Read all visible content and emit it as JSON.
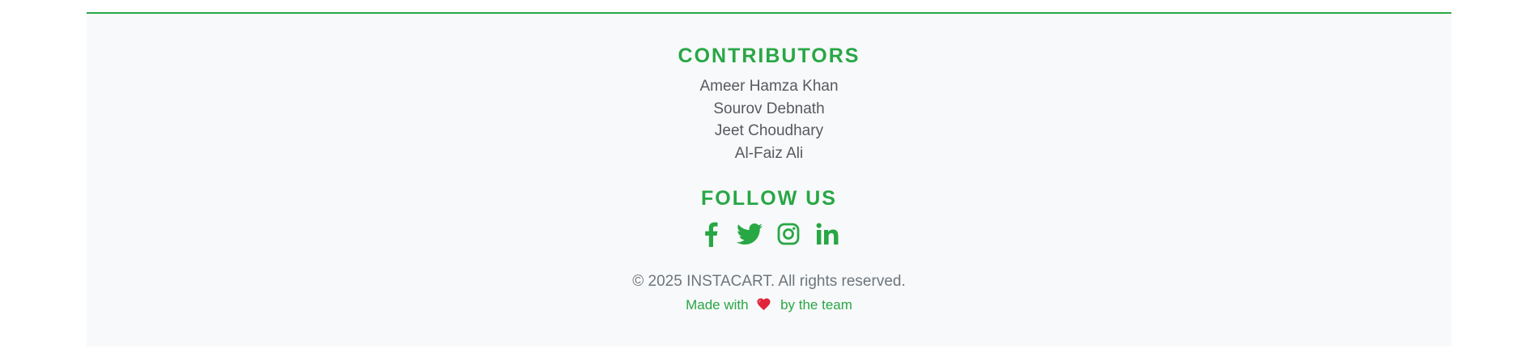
{
  "footer": {
    "contributors_heading": "CONTRIBUTORS",
    "contributors": [
      "Ameer Hamza Khan",
      "Sourov Debnath",
      "Jeet Choudhary",
      "Al-Faiz Ali"
    ],
    "follow_heading": "FOLLOW US",
    "social": [
      {
        "icon": "facebook-icon"
      },
      {
        "icon": "twitter-icon"
      },
      {
        "icon": "instagram-icon"
      },
      {
        "icon": "linkedin-icon"
      }
    ],
    "copyright": "© 2025 INSTACART. All rights reserved.",
    "made_with_prefix": "Made with",
    "made_with_suffix": "by the team",
    "heart_icon": "heart-icon"
  },
  "colors": {
    "accent": "#28a745",
    "background": "#f8f9fa",
    "text": "#555a60",
    "muted": "#6c757d",
    "heart": "#e0243b"
  }
}
